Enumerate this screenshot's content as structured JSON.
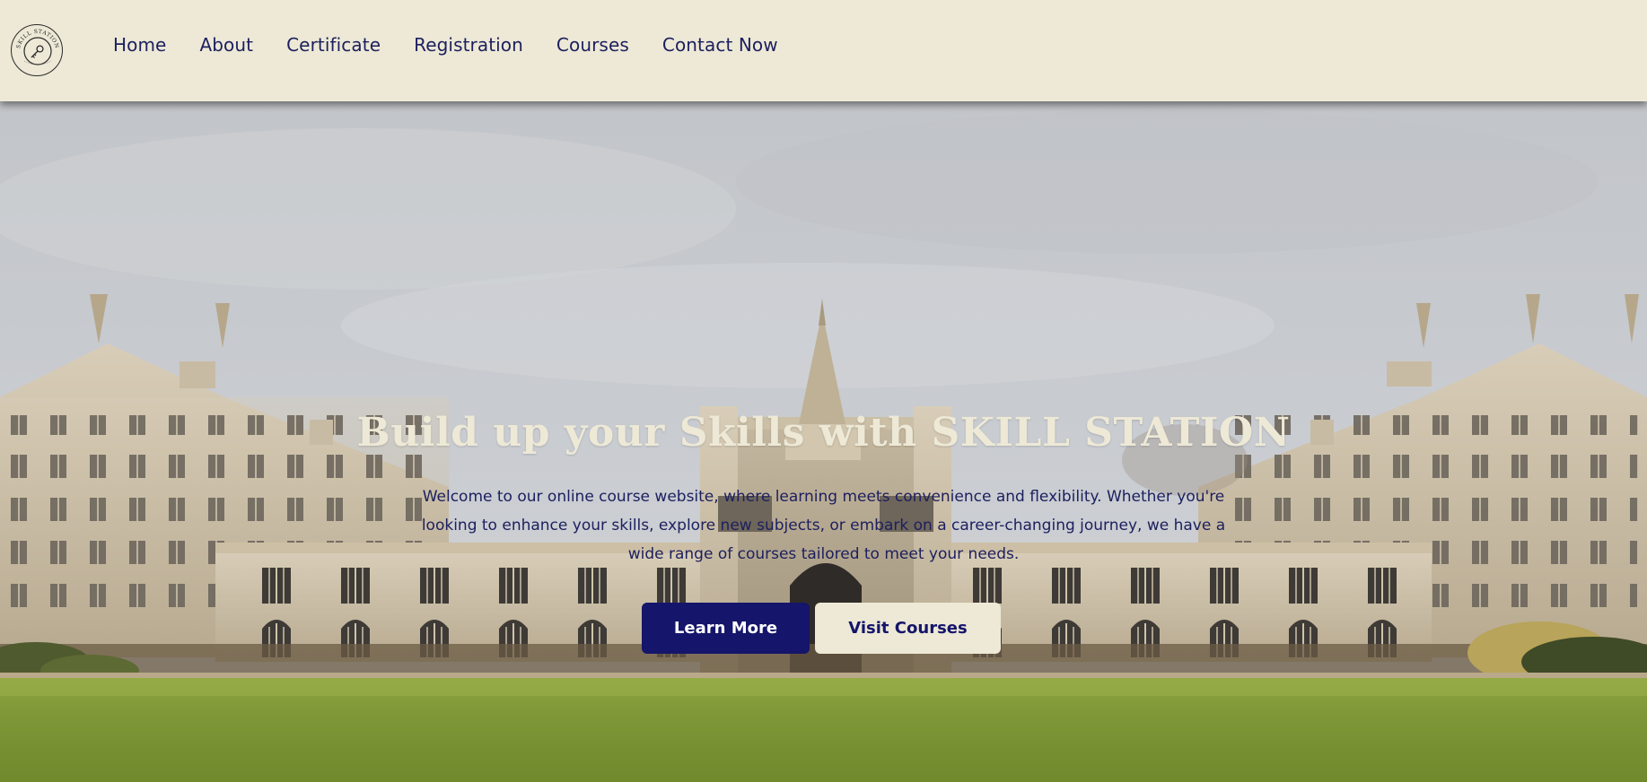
{
  "nav": {
    "logo_text": "SKILL STATION",
    "links": [
      "Home",
      "About",
      "Certificate",
      "Registration",
      "Courses",
      "Contact Now"
    ]
  },
  "hero": {
    "title": "Build up your Skills with SKILL STATION",
    "description": "Welcome to our online course website, where learning meets convenience and flexibility. Whether you're looking to enhance your skills, explore new subjects, or embark on a career-changing journey, we have a wide range of courses tailored to meet your needs.",
    "primary_button": "Learn More",
    "secondary_button": "Visit Courses"
  },
  "colors": {
    "nav_background": "#ede9d6",
    "brand_navy": "#15156b",
    "title_cream": "#ede9d6"
  },
  "icons": {
    "logo": "key-emblem-icon"
  }
}
